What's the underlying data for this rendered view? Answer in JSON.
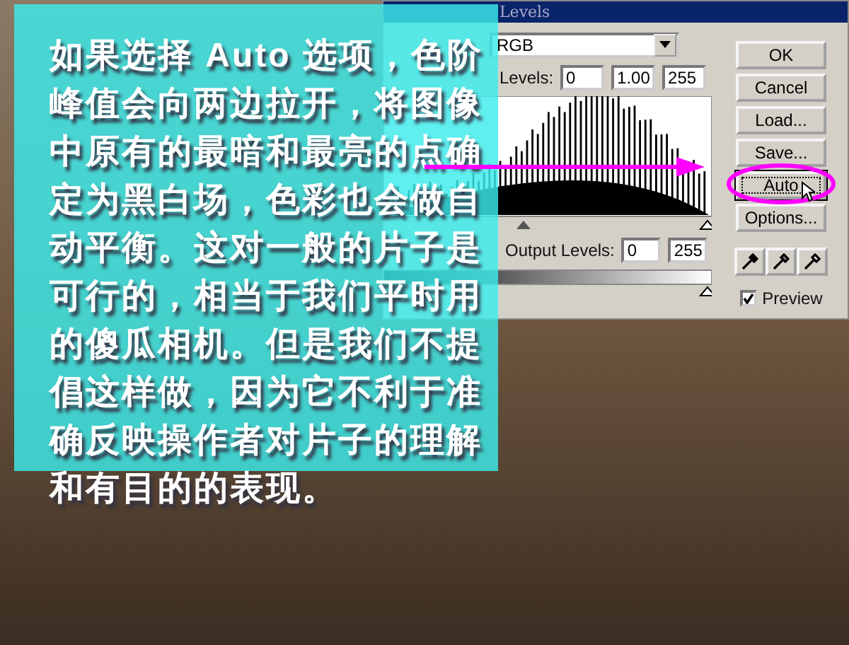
{
  "dialog": {
    "title": "Levels",
    "channel": "RGB",
    "input_label": "Levels:",
    "input_levels": [
      "0",
      "1.00",
      "255"
    ],
    "output_label": "Output Levels:",
    "output_levels": [
      "0",
      "255"
    ],
    "buttons": [
      {
        "label": "OK",
        "selected": false
      },
      {
        "label": "Cancel",
        "selected": false
      },
      {
        "label": "Load...",
        "selected": false
      },
      {
        "label": "Save...",
        "selected": false
      },
      {
        "label": "Auto",
        "selected": true
      },
      {
        "label": "Options...",
        "selected": false
      }
    ],
    "preview": {
      "label": "Preview",
      "checked": true
    }
  },
  "overlay": {
    "text": "如果选择 Auto 选项，色阶峰值会向两边拉开，将图像中原有的最暗和最亮的点确定为黑白场，色彩也会做自动平衡。这对一般的片子是可行的，相当于我们平时用的傻瓜相机。但是我们不提倡这样做，因为它不利于准确反映操作者对片子的理解和有目的的表现。"
  }
}
